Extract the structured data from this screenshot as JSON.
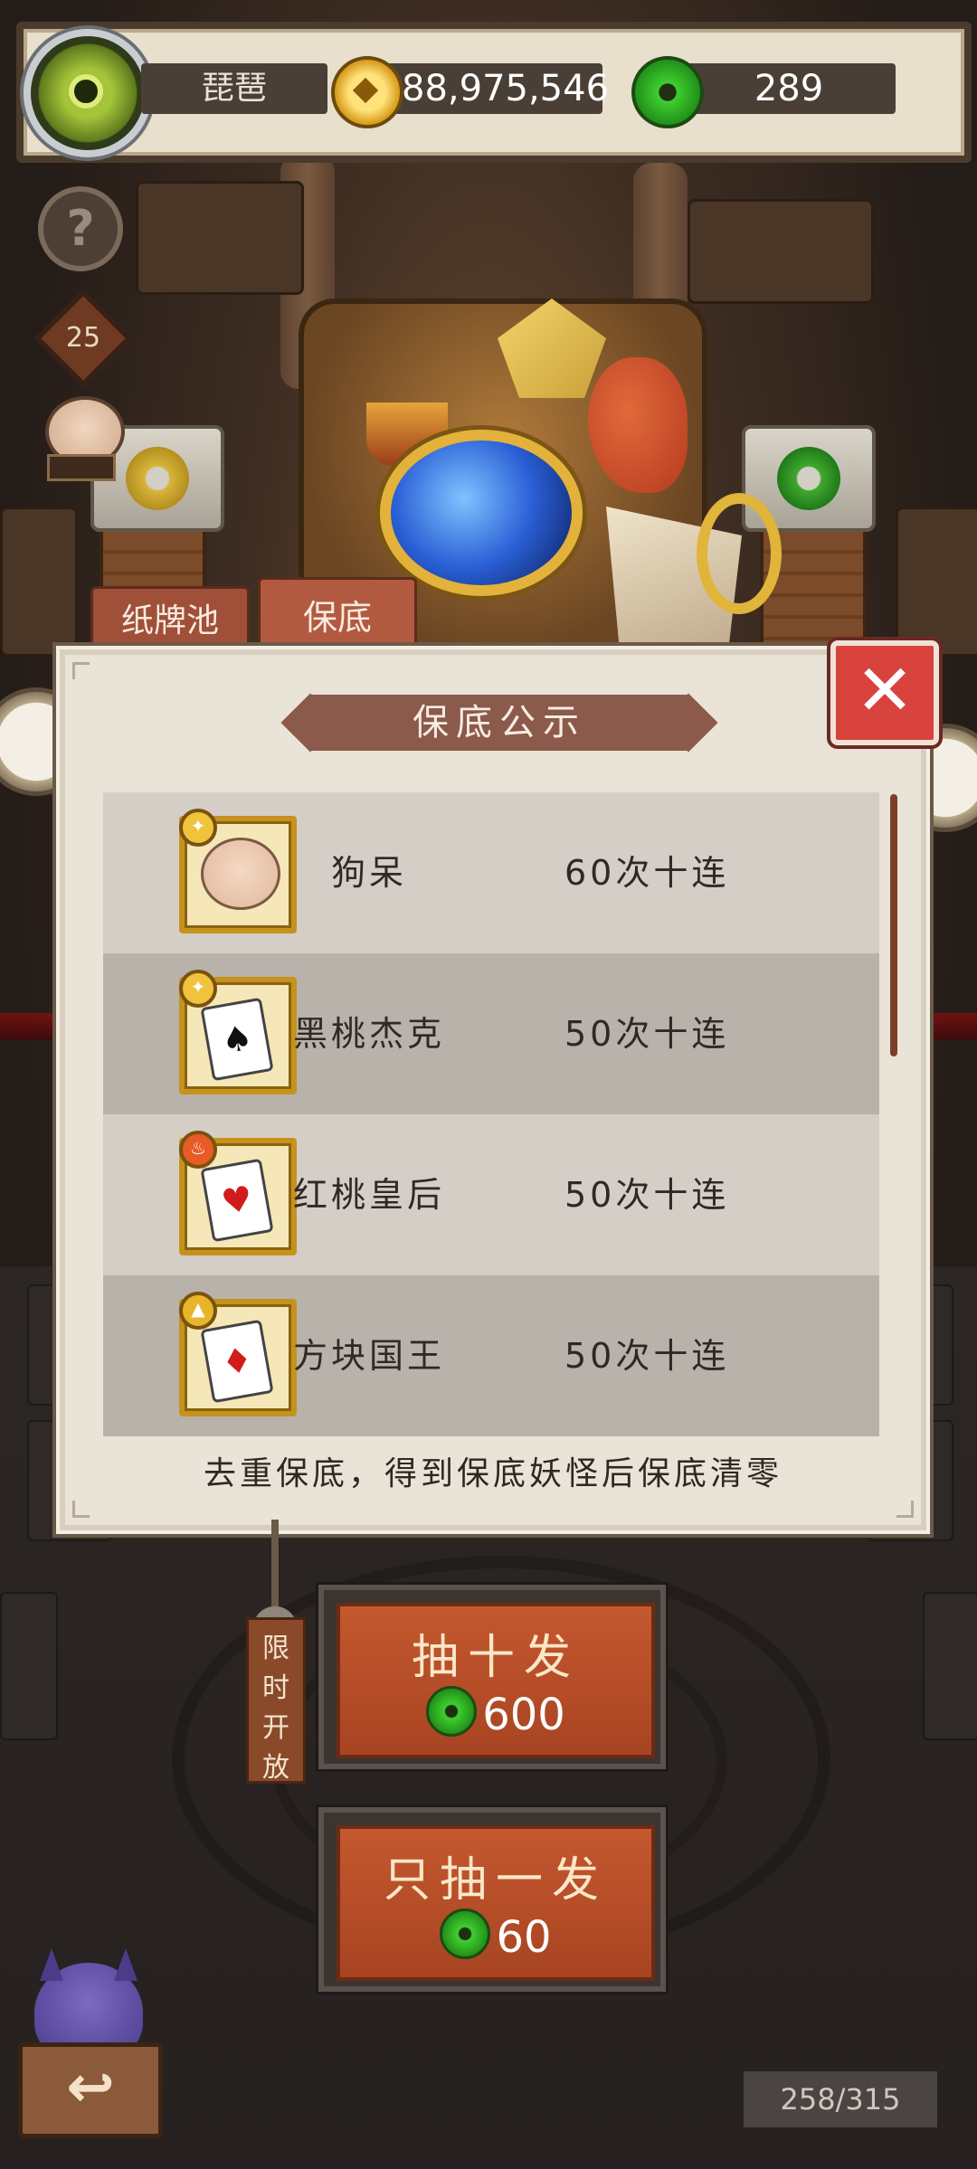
{
  "topbar": {
    "player_name": "琵琶",
    "gold_amount": "88,975,546",
    "jade_amount": "289"
  },
  "side": {
    "help_symbol": "?",
    "level": "25"
  },
  "tabs": [
    {
      "label": "纸牌池",
      "active": false
    },
    {
      "label": "保底",
      "active": true
    }
  ],
  "panel": {
    "title": "保底公示",
    "close_symbol": "✕",
    "items": [
      {
        "name": "狗呆",
        "count": "60次十连",
        "badge": "star-icon",
        "card": "dog"
      },
      {
        "name": "黑桃杰克",
        "count": "50次十连",
        "badge": "star-icon",
        "card": "♠"
      },
      {
        "name": "红桃皇后",
        "count": "50次十连",
        "badge": "fire-icon",
        "card": "♥"
      },
      {
        "name": "方块国王",
        "count": "50次十连",
        "badge": "triangle-icon",
        "card": "♦"
      }
    ],
    "footer_note": "去重保底，得到保底妖怪后保底清零"
  },
  "draw": {
    "ten": {
      "label": "抽十发",
      "price": "600"
    },
    "one": {
      "label": "只抽一发",
      "price": "60"
    },
    "limited_tag": [
      "限",
      "时",
      "开",
      "放"
    ]
  },
  "bottom": {
    "back_symbol": "↩",
    "progress": "258/315"
  },
  "colors": {
    "accent_red": "#d8433e",
    "tab_brown": "#b25a3f",
    "button_orange": "#c4582f",
    "jade_green": "#3fcf2e",
    "gold": "#d69a18"
  }
}
